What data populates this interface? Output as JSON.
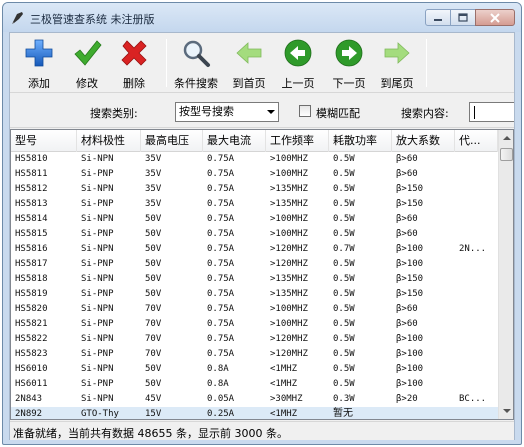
{
  "window": {
    "title": "三极管速查系统 未注册版"
  },
  "toolbar": {
    "buttons": [
      {
        "label": "添加",
        "icon": "add-icon"
      },
      {
        "label": "修改",
        "icon": "check-icon"
      },
      {
        "label": "删除",
        "icon": "delete-icon"
      },
      {
        "label": "条件搜索",
        "icon": "search-icon"
      },
      {
        "label": "到首页",
        "icon": "first-page-icon"
      },
      {
        "label": "上一页",
        "icon": "prev-page-icon"
      },
      {
        "label": "下一页",
        "icon": "next-page-icon"
      },
      {
        "label": "到尾页",
        "icon": "last-page-icon"
      }
    ]
  },
  "search": {
    "category_label": "搜索类别:",
    "category_value": "按型号搜索",
    "fuzzy_label": "模糊匹配",
    "fuzzy_checked": false,
    "content_label": "搜索内容:",
    "content_value": ""
  },
  "table": {
    "columns": [
      "型号",
      "材料极性",
      "最高电压",
      "最大电流",
      "工作频率",
      "耗散功率",
      "放大系数",
      "代..."
    ],
    "rows": [
      [
        "HS5810",
        "Si-NPN",
        "35V",
        "0.75A",
        ">100MHZ",
        "0.5W",
        "β>60",
        ""
      ],
      [
        "HS5811",
        "Si-PNP",
        "35V",
        "0.75A",
        ">100MHZ",
        "0.5W",
        "β>60",
        ""
      ],
      [
        "HS5812",
        "Si-NPN",
        "35V",
        "0.75A",
        ">135MHZ",
        "0.5W",
        "β>150",
        ""
      ],
      [
        "HS5813",
        "Si-PNP",
        "35V",
        "0.75A",
        ">135MHZ",
        "0.5W",
        "β>150",
        ""
      ],
      [
        "HS5814",
        "Si-NPN",
        "50V",
        "0.75A",
        ">100MHZ",
        "0.5W",
        "β>60",
        ""
      ],
      [
        "HS5815",
        "Si-PNP",
        "50V",
        "0.75A",
        ">100MHZ",
        "0.5W",
        "β>60",
        ""
      ],
      [
        "HS5816",
        "Si-NPN",
        "50V",
        "0.75A",
        ">120MHZ",
        "0.7W",
        "β>100",
        "2N..."
      ],
      [
        "HS5817",
        "Si-PNP",
        "50V",
        "0.75A",
        ">120MHZ",
        "0.5W",
        "β>100",
        ""
      ],
      [
        "HS5818",
        "Si-NPN",
        "50V",
        "0.75A",
        ">135MHZ",
        "0.5W",
        "β>150",
        ""
      ],
      [
        "HS5819",
        "Si-PNP",
        "50V",
        "0.75A",
        ">135MHZ",
        "0.5W",
        "β>150",
        ""
      ],
      [
        "HS5820",
        "Si-NPN",
        "70V",
        "0.75A",
        ">100MHZ",
        "0.5W",
        "β>60",
        ""
      ],
      [
        "HS5821",
        "Si-PNP",
        "70V",
        "0.75A",
        ">100MHZ",
        "0.5W",
        "β>60",
        ""
      ],
      [
        "HS5822",
        "Si-NPN",
        "70V",
        "0.75A",
        ">120MHZ",
        "0.5W",
        "β>100",
        ""
      ],
      [
        "HS5823",
        "Si-PNP",
        "70V",
        "0.75A",
        ">120MHZ",
        "0.5W",
        "β>100",
        ""
      ],
      [
        "HS6010",
        "Si-NPN",
        "50V",
        "0.8A",
        "<1MHZ",
        "0.5W",
        "β>100",
        ""
      ],
      [
        "HS6011",
        "Si-PNP",
        "50V",
        "0.8A",
        "<1MHZ",
        "0.5W",
        "β>100",
        ""
      ],
      [
        "2N843",
        "Si-NPN",
        "45V",
        "0.05A",
        ">30MHZ",
        "0.3W",
        "β>20",
        "BC..."
      ],
      [
        "2N892",
        "GTO-Thy",
        "15V",
        "0.25A",
        "<1MHZ",
        "暂无",
        "",
        ""
      ]
    ],
    "selected_row": 17
  },
  "status": {
    "text": "准备就绪，当前共有数据 48655 条，显示前 3000 条。"
  },
  "colors": {
    "accent_blue": "#1f6fd1",
    "check_green": "#3aa02a",
    "delete_red": "#d42020",
    "nav_green": "#2f9a2a",
    "selection": "#dceaf7"
  }
}
